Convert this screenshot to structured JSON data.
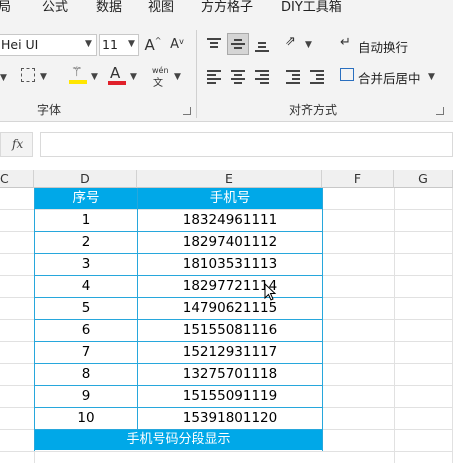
{
  "ribbon_tabs": [
    "局",
    "公式",
    "数据",
    "视图",
    "方方格子",
    "DIY工具箱"
  ],
  "font": {
    "name": "Hei UI",
    "size": "11",
    "grow_glyph": "A",
    "shrink_glyph": "A",
    "color_glyph": "A",
    "pinyin_top": "wén",
    "pinyin_bottom": "文"
  },
  "groups": {
    "font_label": "字体",
    "align_label": "对齐方式"
  },
  "alignment": {
    "wrap_text": "自动换行",
    "merge_center": "合并后居中"
  },
  "formula_bar": {
    "fx_label": "fx",
    "value": ""
  },
  "columns": [
    "C",
    "D",
    "E",
    "F",
    "G"
  ],
  "table": {
    "headers": {
      "index": "序号",
      "phone": "手机号"
    },
    "rows": [
      {
        "index": "1",
        "phone": "18324961111"
      },
      {
        "index": "2",
        "phone": "18297401112"
      },
      {
        "index": "3",
        "phone": "18103531113"
      },
      {
        "index": "4",
        "phone": "18297721114"
      },
      {
        "index": "5",
        "phone": "14790621115"
      },
      {
        "index": "6",
        "phone": "15155081116"
      },
      {
        "index": "7",
        "phone": "15212931117"
      },
      {
        "index": "8",
        "phone": "13275701118"
      },
      {
        "index": "9",
        "phone": "15155091119"
      },
      {
        "index": "10",
        "phone": "15391801120"
      }
    ],
    "footer": "手机号码分段显示"
  },
  "colors": {
    "header_fill": "#00a8e8",
    "font_color_bar": "#e0202a",
    "fill_color_bar": "#ffe600"
  }
}
